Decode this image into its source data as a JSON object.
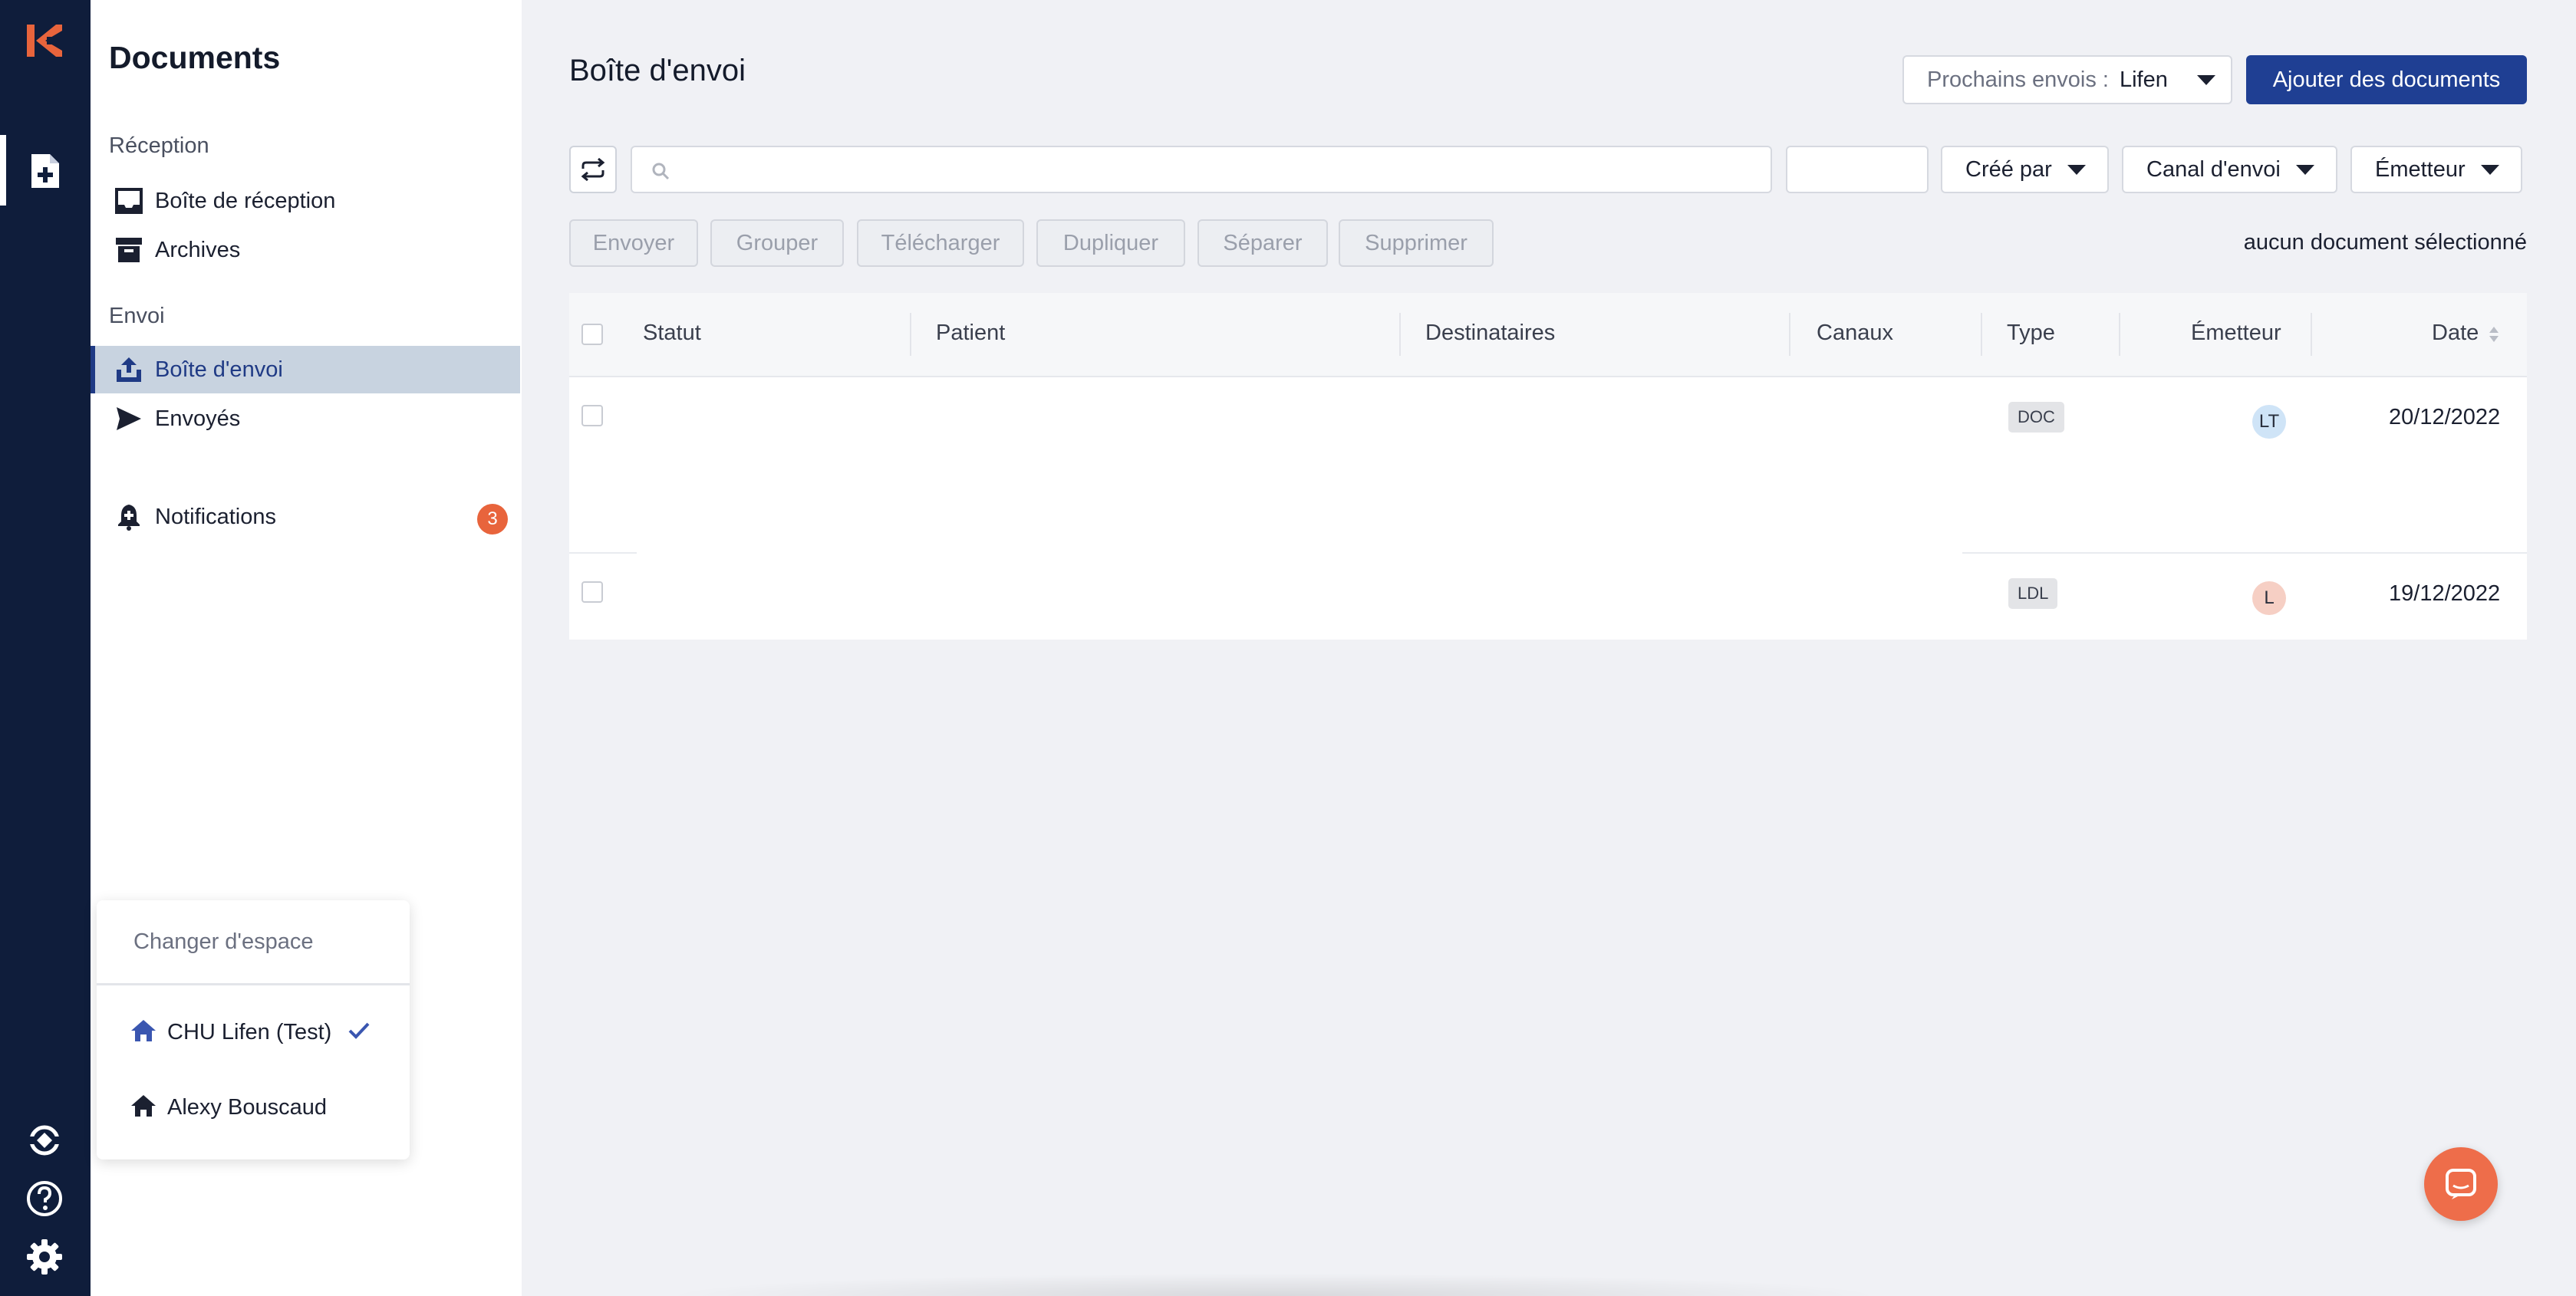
{
  "sidebar": {
    "title": "Documents",
    "sections": {
      "reception": "Réception",
      "envoi": "Envoi"
    },
    "items": [
      {
        "label": "Boîte de réception"
      },
      {
        "label": "Archives"
      },
      {
        "label": "Boîte d'envoi"
      },
      {
        "label": "Envoyés"
      },
      {
        "label": "Notifications",
        "badge": "3"
      }
    ]
  },
  "space_menu": {
    "header": "Changer d'espace",
    "items": [
      {
        "label": "CHU Lifen (Test)",
        "selected": true
      },
      {
        "label": "Alexy Bouscaud",
        "selected": false
      }
    ]
  },
  "header": {
    "title": "Boîte d'envoi",
    "next_sends_label": "Prochains envois :",
    "next_sends_value": "Lifen",
    "add_button": "Ajouter des documents"
  },
  "toolbar": {
    "search_placeholder": "",
    "filters": {
      "created_by": "Créé par",
      "channel": "Canal d'envoi",
      "sender": "Émetteur"
    },
    "actions": {
      "send": "Envoyer",
      "group": "Grouper",
      "download": "Télécharger",
      "duplicate": "Dupliquer",
      "split": "Séparer",
      "delete": "Supprimer"
    },
    "selection_status": "aucun document sélectionné"
  },
  "table": {
    "columns": {
      "status": "Statut",
      "patient": "Patient",
      "recipients": "Destinataires",
      "channels": "Canaux",
      "type": "Type",
      "sender": "Émetteur",
      "date": "Date"
    },
    "rows": [
      {
        "type": "DOC",
        "sender_initials": "LT",
        "date": "20/12/2022"
      },
      {
        "type": "LDL",
        "sender_initials": "L",
        "date": "19/12/2022"
      }
    ]
  },
  "colors": {
    "rail": "#0f1d3b",
    "primary": "#1f3f93",
    "accent_orange": "#e8643c",
    "active_item_bg": "#c8d3e0"
  }
}
